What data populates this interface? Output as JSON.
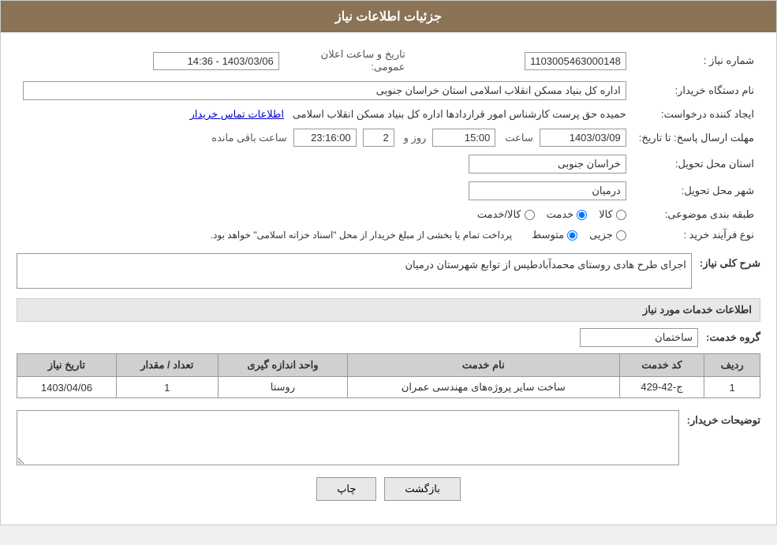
{
  "header": {
    "title": "جزئیات اطلاعات نیاز"
  },
  "fields": {
    "need_number_label": "شماره نیاز :",
    "need_number_value": "1103005463000148",
    "org_name_label": "نام دستگاه خریدار:",
    "org_name_value": "اداره کل بنیاد مسکن انقلاب اسلامی استان خراسان جنوبی",
    "creator_label": "ایجاد کننده درخواست:",
    "creator_value": "حمیده حق پرست کارشناس امور قراردادها اداره کل بنیاد مسکن انقلاب اسلامی",
    "creator_link": "اطلاعات تماس خریدار",
    "announce_datetime_label": "تاریخ و ساعت اعلان عمومی:",
    "announce_datetime_value": "1403/03/06 - 14:36",
    "reply_deadline_label": "مهلت ارسال پاسخ: تا تاریخ:",
    "reply_date": "1403/03/09",
    "reply_time_label": "ساعت",
    "reply_time_value": "15:00",
    "reply_day_label": "روز و",
    "reply_day_value": "2",
    "reply_remaining_label": "ساعت باقی مانده",
    "reply_remaining_value": "23:16:00",
    "province_label": "استان محل تحویل:",
    "province_value": "خراسان جنوبی",
    "city_label": "شهر محل تحویل:",
    "city_value": "درمیان",
    "category_label": "طبقه بندی موضوعی:",
    "category_options": [
      "کالا",
      "خدمت",
      "کالا/خدمت"
    ],
    "category_selected": "خدمت",
    "purchase_type_label": "نوع فرآیند خرید :",
    "purchase_note": "پرداخت تمام یا بخشی از مبلغ خریدار از محل \"اسناد خزانه اسلامی\" خواهد بود.",
    "purchase_options": [
      "جزیی",
      "متوسط"
    ],
    "purchase_selected": "متوسط",
    "need_description_label": "شرح کلی نیاز:",
    "need_description_value": "اجرای طرح هادی روستای محمدآبادطیس از توابع شهرستان درمیان",
    "services_section_label": "اطلاعات خدمات مورد نیاز",
    "service_group_label": "گروه خدمت:",
    "service_group_value": "ساختمان",
    "table_headers": [
      "ردیف",
      "کد خدمت",
      "نام خدمت",
      "واحد اندازه گیری",
      "تعداد / مقدار",
      "تاریخ نیاز"
    ],
    "table_rows": [
      {
        "row": "1",
        "code": "ج-42-429",
        "name": "ساخت سایر پروژه‌های مهندسی عمران",
        "unit": "روستا",
        "quantity": "1",
        "date": "1403/04/06"
      }
    ],
    "buyer_desc_label": "توضیحات خریدار:",
    "buyer_desc_value": "",
    "btn_print": "چاپ",
    "btn_back": "بازگشت"
  }
}
